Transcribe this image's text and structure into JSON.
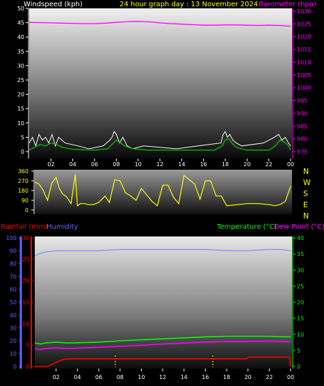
{
  "colors": {
    "white": "#ffffff",
    "yellow": "#ffff00",
    "magenta": "#ff00ff",
    "red": "#ff0000",
    "blue": "#6666ff",
    "green": "#00ff00",
    "gust": "#ffffff",
    "wind_avg": "#00cc00",
    "dir": "#ffff00",
    "temp": "#00ff00",
    "dew": "#ff00ff",
    "humidity": "#8888ff",
    "rain": "#ff0000"
  },
  "header": {
    "left": "Windspeed (kph)",
    "center": "24 hour graph day : 13 November 2024",
    "right": "Barometer (hpa)"
  },
  "bottom_header": {
    "rainfall": "Rainfall (mm)",
    "humidity": "Humidity",
    "temperature": "Temperature (°C)",
    "dewpoint": "Dew Point (°C)"
  },
  "compass": [
    "N",
    "W",
    "S",
    "E",
    "N"
  ],
  "chart_data": [
    {
      "type": "line",
      "title": "24 hour graph day : 13 November 2024",
      "x_ticks": [
        "02",
        "04",
        "06",
        "08",
        "10",
        "12",
        "14",
        "16",
        "18",
        "20",
        "22",
        "00"
      ],
      "y_left": {
        "label": "Windspeed (kph)",
        "ticks": [
          0,
          5,
          10,
          15,
          20,
          25,
          30,
          35,
          40,
          45,
          50
        ],
        "range": [
          0,
          50
        ]
      },
      "y_right": {
        "label": "Barometer (hpa)",
        "ticks": [
          975,
          980,
          985,
          990,
          995,
          1000,
          1005,
          1010,
          1015,
          1020,
          1025,
          1030
        ],
        "range": [
          975,
          1030
        ]
      },
      "series": [
        {
          "name": "Barometer (hpa)",
          "axis": "right",
          "x": [
            0,
            1,
            2,
            3,
            4,
            5,
            6,
            7,
            8,
            9,
            10,
            11,
            12,
            13,
            14,
            15,
            16,
            17,
            18,
            19,
            20,
            21,
            22,
            23,
            24
          ],
          "y": [
            1025.6,
            1025.5,
            1025.4,
            1025.3,
            1025.2,
            1025.1,
            1025.1,
            1025.3,
            1025.6,
            1025.9,
            1026.0,
            1025.8,
            1025.4,
            1025.1,
            1024.9,
            1024.7,
            1024.5,
            1024.5,
            1024.6,
            1024.6,
            1024.5,
            1024.4,
            1024.5,
            1024.4,
            1024.1
          ]
        },
        {
          "name": "Wind gust",
          "axis": "left",
          "x": [
            0,
            0.3,
            0.6,
            0.9,
            1.2,
            1.5,
            1.8,
            2.1,
            2.4,
            2.7,
            3.0,
            3.3,
            4.5,
            5.5,
            6.8,
            7.4,
            7.6,
            7.8,
            8.0,
            8.3,
            8.6,
            9.0,
            9.5,
            10.5,
            13.5,
            15.5,
            17.6,
            17.8,
            18.0,
            18.2,
            18.4,
            18.7,
            19.0,
            19.5,
            21.5,
            22.5,
            22.9,
            23.2,
            23.5,
            23.8,
            24
          ],
          "y": [
            3,
            5,
            2,
            6,
            4,
            5,
            3,
            6,
            2,
            5,
            4,
            3,
            2,
            1,
            2,
            4,
            5,
            7,
            6,
            3,
            5,
            2,
            1,
            2,
            1,
            2,
            3,
            6,
            7,
            5,
            6,
            4,
            3,
            2,
            3,
            5,
            6,
            4,
            5,
            3,
            2
          ]
        },
        {
          "name": "Wind average",
          "axis": "left",
          "x": [
            0,
            0.5,
            1.0,
            1.5,
            2.0,
            2.5,
            3.0,
            4.0,
            6.0,
            7.2,
            7.6,
            8.0,
            8.4,
            8.8,
            9.5,
            11,
            14,
            17,
            17.7,
            18.0,
            18.3,
            18.6,
            19,
            20,
            22,
            22.6,
            23.0,
            23.4,
            23.8,
            24
          ],
          "y": [
            0.5,
            1.5,
            2.5,
            2,
            3,
            2.5,
            1.5,
            0.8,
            0.5,
            1,
            2.5,
            4,
            3,
            2,
            1,
            0.5,
            0.5,
            0.5,
            2,
            4,
            4.5,
            3,
            1.5,
            0.5,
            0.5,
            2,
            4,
            3.5,
            2,
            0.5
          ]
        }
      ]
    },
    {
      "type": "line",
      "x_ticks": [
        "02",
        "04",
        "06",
        "08",
        "10",
        "12",
        "14",
        "16",
        "18",
        "20",
        "22",
        "00"
      ],
      "y_left": {
        "ticks": [
          0,
          90,
          180,
          270,
          360
        ],
        "range": [
          0,
          360
        ]
      },
      "y_right_labels": [
        "N",
        "W",
        "S",
        "E",
        "N"
      ],
      "series": [
        {
          "name": "Wind direction",
          "axis": "left",
          "x": [
            0,
            0.4,
            0.8,
            1.2,
            1.6,
            2.0,
            2.3,
            2.6,
            3.0,
            3.4,
            3.8,
            4.0,
            4.3,
            4.7,
            5.0,
            5.5,
            6.0,
            6.3,
            6.6,
            7.0,
            7.5,
            8.0,
            8.5,
            9.0,
            9.5,
            10.0,
            10.5,
            11.0,
            11.5,
            12.0,
            12.5,
            13.0,
            13.5,
            14.0,
            14.5,
            15.0,
            15.5,
            16.0,
            16.5,
            17.0,
            17.5,
            18.0,
            19.0,
            20.0,
            21.0,
            22.0,
            22.5,
            23.0,
            23.5,
            24
          ],
          "y": [
            260,
            240,
            180,
            90,
            250,
            300,
            200,
            150,
            120,
            60,
            330,
            40,
            60,
            60,
            50,
            50,
            70,
            100,
            130,
            70,
            280,
            270,
            160,
            130,
            90,
            200,
            140,
            80,
            40,
            230,
            230,
            120,
            60,
            320,
            280,
            240,
            100,
            270,
            270,
            130,
            130,
            40,
            50,
            60,
            60,
            50,
            40,
            50,
            80,
            220
          ]
        }
      ]
    },
    {
      "type": "line",
      "x_ticks": [
        "02",
        "04",
        "06",
        "08",
        "10",
        "12",
        "14",
        "16",
        "18",
        "20",
        "22",
        "00"
      ],
      "y_left_humidity": {
        "label": "Humidity",
        "ticks": [
          0,
          10,
          20,
          30,
          40,
          50,
          60,
          70,
          80,
          90,
          100
        ],
        "range": [
          0,
          100
        ]
      },
      "y_left_rain": {
        "label": "Rainfall (mm)",
        "ticks": [
          0,
          5,
          10,
          15,
          20,
          25,
          30
        ],
        "range": [
          0,
          30
        ]
      },
      "y_right": {
        "label": "Temperature (°C) Dew Point (°C)",
        "ticks": [
          0,
          5,
          10,
          15,
          20,
          25,
          30,
          35,
          40
        ],
        "range": [
          0,
          40
        ]
      },
      "series": [
        {
          "name": "Humidity",
          "axis": "humidity",
          "x": [
            0,
            0.5,
            1.0,
            2.0,
            4.0,
            6.0,
            8.0,
            10.0,
            12.0,
            14.0,
            16.0,
            18.0,
            20.0,
            22.0,
            23.0,
            24
          ],
          "y": [
            86,
            88,
            89,
            90,
            90,
            90,
            91,
            91,
            91,
            91,
            91,
            90,
            90,
            91,
            91,
            90
          ]
        },
        {
          "name": "Temperature (°C)",
          "axis": "right",
          "x": [
            0,
            0.5,
            1.0,
            2.0,
            3.0,
            4.0,
            6.0,
            8.0,
            10.0,
            12.0,
            14.0,
            16.0,
            18.0,
            20.0,
            22.0,
            24
          ],
          "y": [
            7.3,
            7.0,
            7.3,
            7.6,
            7.3,
            7.4,
            7.6,
            8.0,
            8.3,
            8.6,
            8.9,
            9.2,
            9.4,
            9.4,
            9.4,
            9.2
          ]
        },
        {
          "name": "Dew Point (°C)",
          "axis": "right",
          "x": [
            0,
            0.5,
            1.0,
            2.0,
            3.0,
            4.0,
            6.0,
            8.0,
            10.0,
            12.0,
            14.0,
            16.0,
            18.0,
            20.0,
            22.0,
            24
          ],
          "y": [
            5.6,
            5.3,
            5.6,
            5.8,
            5.6,
            5.7,
            6.0,
            6.3,
            6.6,
            7.0,
            7.3,
            7.6,
            7.8,
            7.8,
            7.9,
            7.7
          ]
        },
        {
          "name": "Rainfall (mm)",
          "axis": "rain",
          "x": [
            0,
            1.2,
            2.0,
            2.6,
            3.0,
            6.0,
            10.0,
            14.0,
            19.9,
            20.0,
            23.9,
            24
          ],
          "y": [
            0,
            0,
            1,
            1.6,
            1.8,
            1.8,
            1.8,
            1.8,
            1.8,
            2.2,
            2.2,
            0
          ]
        }
      ],
      "markers": [
        7.55,
        16.7
      ]
    }
  ]
}
